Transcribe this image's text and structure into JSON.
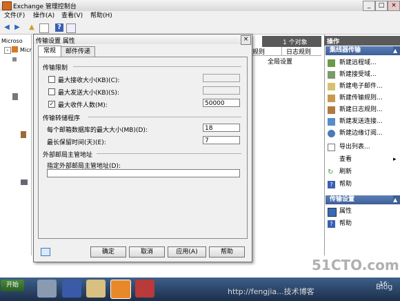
{
  "window": {
    "title": "Exchange 管理控制台",
    "min": "_",
    "max": "□",
    "close": "×"
  },
  "menu": [
    "文件(F)",
    "操作(A)",
    "查看(V)",
    "帮助(H)"
  ],
  "tree": {
    "item1": "Microso",
    "item2": "Micro"
  },
  "center": {
    "count": "1 个对象",
    "tab1": "规则",
    "tab2": "日志规则",
    "row_header": "全局设置"
  },
  "actions": {
    "title": "操作",
    "section1": "集线器传输",
    "items": [
      "新建远程域...",
      "新建接受域...",
      "新建电子邮件...",
      "新建传输规则...",
      "新建日志规则...",
      "新建发送连接...",
      "新建边缘订阅...",
      "导出列表...",
      "查看",
      "刷新",
      "帮助"
    ],
    "section2": "传输设置",
    "items2": [
      "属性",
      "帮助"
    ]
  },
  "dialog": {
    "title": "传输设置 属性",
    "close": "×",
    "tabs": [
      "常规",
      "邮件传递"
    ],
    "group1": "传输限制",
    "max_receive_label": "最大接收大小(KB)(C):",
    "max_receive_checked": false,
    "max_receive_value": "",
    "max_send_label": "最大发送大小(KB)(S):",
    "max_send_checked": false,
    "max_send_value": "",
    "max_recipients_label": "最大收件人数(M):",
    "max_recipients_checked": true,
    "max_recipients_value": "50000",
    "group2": "传输转储程序",
    "dumpster_size_label": "每个邮箱数据库的最大大小(MB)(D):",
    "dumpster_size_value": "18",
    "retention_label": "最长保留时间(天)(E):",
    "retention_value": "7",
    "group3": "外部邮局主管地址",
    "postmaster_label": "指定外部邮局主管地址(D):",
    "postmaster_value": "",
    "buttons": {
      "ok": "确定",
      "cancel": "取消",
      "apply": "应用(A)",
      "help": "帮助"
    }
  },
  "taskbar": {
    "start": "开始",
    "clock": "16:"
  },
  "watermark": {
    "brand": "51CTO.com",
    "url": "http://fengjia...技术博客",
    "blog": "Blog"
  },
  "colors": {
    "section_header": "#4a6ea8",
    "panel_header": "#5a5a5a",
    "taskbar": "#2b4466"
  }
}
